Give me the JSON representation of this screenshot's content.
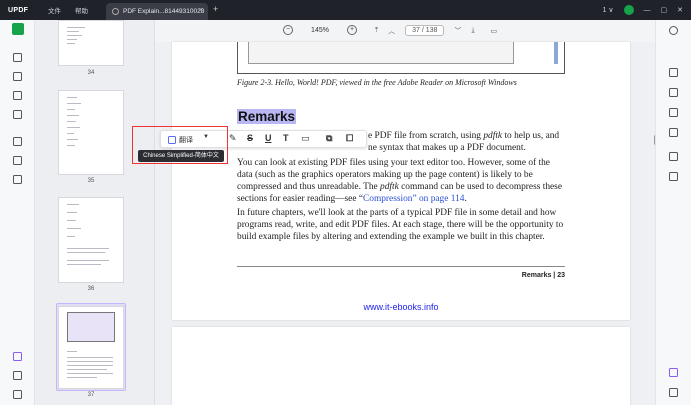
{
  "app": {
    "logo": "UPDF",
    "menus": [
      "文件",
      "帮助"
    ],
    "tab_title": "PDF Explain...81449310028",
    "tab_close": "×",
    "new_tab": "+",
    "version": "1",
    "avatar_initial": "",
    "accent_color": "#16a34a"
  },
  "doc_toolbar": {
    "zoom_out": "−",
    "zoom_value": "145%",
    "zoom_in": "+",
    "current_page": "37",
    "total_pages": "138"
  },
  "thumbnails": [
    {
      "label": "34"
    },
    {
      "label": "35"
    },
    {
      "label": "36"
    },
    {
      "label": "37"
    }
  ],
  "page": {
    "caption": "Figure 2-3. Hello, World! PDF, viewed in the free Adobe Reader on Microsoft Windows",
    "heading": "Remarks",
    "para1_part1": "e PDF file from scratch, using ",
    "para1_italic": "pdftk",
    "para1_part2": " to help us, and",
    "para1_line2": "ne syntax that makes up a PDF document.",
    "para2_part1": "You can look at existing PDF files using your text editor too. However, some of the data (such as the graphics operators making up the page content) is likely to be compressed and thus unreadable. The ",
    "para2_italic": "pdftk",
    "para2_part2": " command can be used to decompress these sections for easier reading—see “",
    "para2_link": "Compression” on page 114",
    "para2_end": ".",
    "para3": "In future chapters, we'll look at the parts of a typical PDF file in some detail and how programs read, write, and edit PDF files. At each stage, there will be the opportunity to build example files by altering and extending the example we built in this chapter.",
    "footer": "Remarks  |  23",
    "url": "www.it-ebooks.info"
  },
  "float_toolbar": {
    "translate_label": "翻译",
    "caret": "▼",
    "tooltip": "Chinese Simplified-简体中文"
  }
}
